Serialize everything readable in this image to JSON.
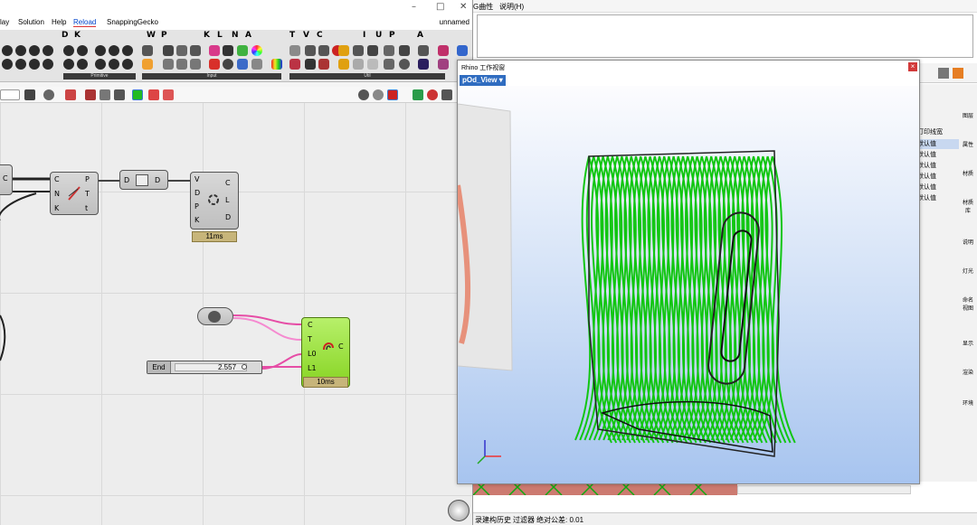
{
  "grasshopper": {
    "menu": {
      "items": [
        "lay",
        "Solution",
        "Help",
        "Reload",
        "SnappingGecko"
      ],
      "filename": "unnamed"
    },
    "window_controls": [
      "–",
      "□",
      "✕"
    ],
    "ribbon": {
      "tab_letters": [
        "D",
        "K",
        "W",
        "P",
        "K",
        "L",
        "N",
        "A",
        "T",
        "V",
        "C",
        "I",
        "U",
        "P",
        "A"
      ],
      "groups": [
        "Primitive",
        "Input",
        "Util"
      ]
    },
    "components": {
      "c1": {
        "inputs": [
          "C",
          "N",
          "K"
        ],
        "outputs": [
          "P",
          "T",
          "t"
        ]
      },
      "c2": {
        "inputs": [
          "D"
        ],
        "outputs": [
          "D"
        ]
      },
      "c3": {
        "inputs": [
          "V",
          "D",
          "P",
          "K"
        ],
        "outputs": [
          "C",
          "L",
          "D"
        ],
        "timer": "11ms"
      },
      "left_stub": {
        "outputs": [
          "C"
        ]
      },
      "c4": {
        "inputs": [
          "C",
          "T",
          "L0",
          "L1"
        ],
        "outputs": [
          "C"
        ],
        "timer": "10ms"
      },
      "slider": {
        "label": "End",
        "value": "2.557"
      }
    }
  },
  "rhino": {
    "menu": [
      "G曲性",
      "说明(H)"
    ],
    "viewport_window": {
      "title": "Rhino 工作视窗",
      "tab": "pOd_View"
    },
    "layers": {
      "header": "打印线宽",
      "rows": [
        "默认值",
        "默认值",
        "默认值",
        "默认值",
        "默认值",
        "默认值"
      ]
    },
    "side_tabs": [
      "图层",
      "属性",
      "材质",
      "材质库",
      "说明",
      "灯光",
      "命名视图",
      "显示",
      "渲染",
      "环境"
    ],
    "status": [
      "录建构历史",
      "过滤器",
      "绝对公差: 0.01"
    ],
    "colors": {
      "mesh_green": "#11c611",
      "viewport_tab": "#2f6cc0",
      "grass_pink": "#e06090"
    }
  }
}
